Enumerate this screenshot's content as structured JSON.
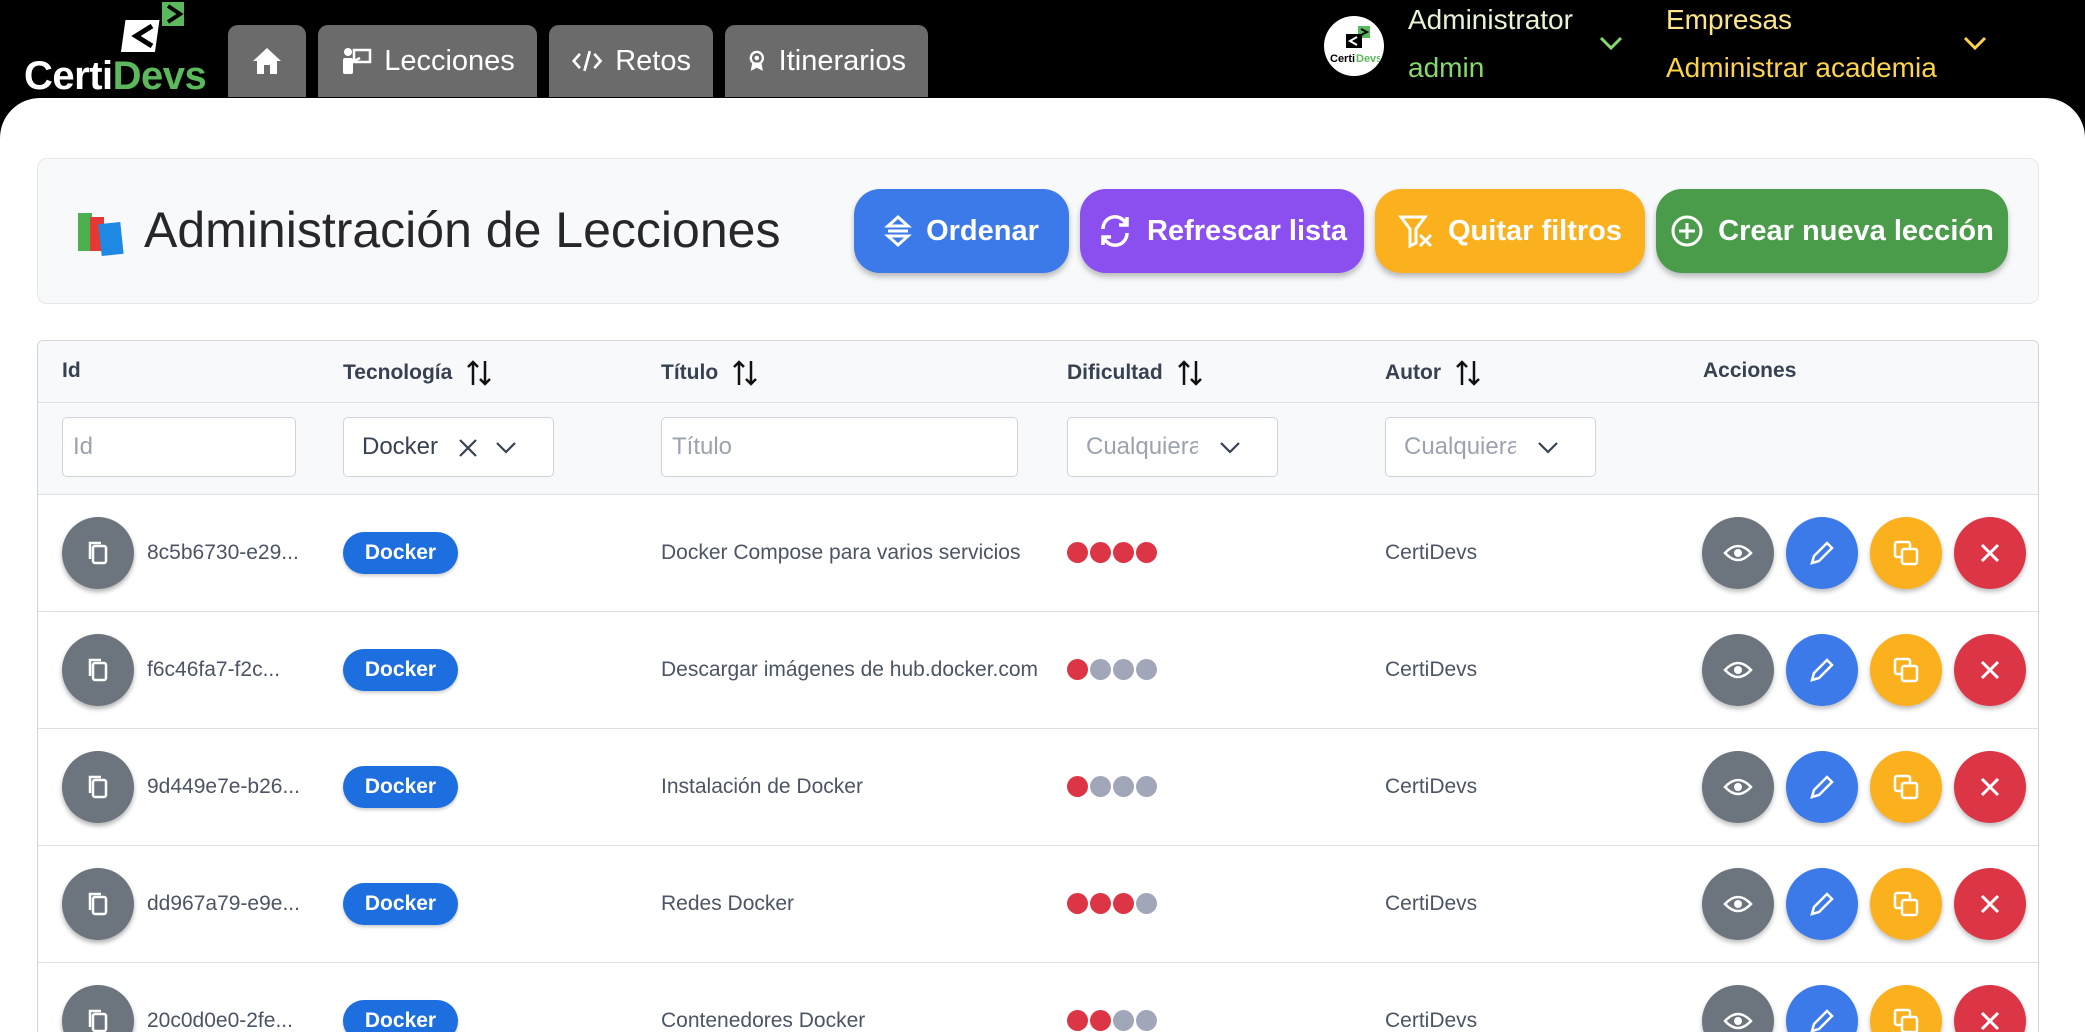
{
  "app": {
    "logo_text_part1": "Certi",
    "logo_text_part2": "Devs"
  },
  "nav": {
    "tabs": [
      {
        "label": "",
        "icon": "home-icon"
      },
      {
        "label": "Lecciones",
        "icon": "teacher-icon"
      },
      {
        "label": "Retos",
        "icon": "code-icon"
      },
      {
        "label": "Itinerarios",
        "icon": "award-icon"
      }
    ]
  },
  "user": {
    "name": "Administrator",
    "role": "admin"
  },
  "company": {
    "name": "Empresas",
    "role": "Administrar academia"
  },
  "page": {
    "title": "Administración de Lecciones"
  },
  "actions": {
    "sort_label": "Ordenar",
    "refresh_label": "Refrescar lista",
    "clear_filters_label": "Quitar filtros",
    "create_label": "Crear nueva lección"
  },
  "table": {
    "columns": {
      "id": "Id",
      "tech": "Tecnología",
      "title": "Título",
      "difficulty": "Dificultad",
      "author": "Autor",
      "actions": "Acciones"
    },
    "filters": {
      "id_placeholder": "Id",
      "tech_value": "Docker",
      "title_placeholder": "Título",
      "difficulty_placeholder": "Cualquiera",
      "author_placeholder": "Cualquiera"
    },
    "rows": [
      {
        "id": "8c5b6730-e29...",
        "tech": "Docker",
        "title": "Docker Compose para varios servicios",
        "difficulty": 4,
        "author": "CertiDevs"
      },
      {
        "id": "f6c46fa7-f2c...",
        "tech": "Docker",
        "title": "Descargar imágenes de hub.docker.com",
        "difficulty": 1,
        "author": "CertiDevs"
      },
      {
        "id": "9d449e7e-b26...",
        "tech": "Docker",
        "title": "Instalación de Docker",
        "difficulty": 1,
        "author": "CertiDevs"
      },
      {
        "id": "dd967a79-e9e...",
        "tech": "Docker",
        "title": "Redes Docker",
        "difficulty": 3,
        "author": "CertiDevs"
      },
      {
        "id": "20c0d0e0-2fe...",
        "tech": "Docker",
        "title": "Contenedores Docker",
        "difficulty": 2,
        "author": "CertiDevs"
      }
    ]
  },
  "colors": {
    "primary": "#3b7ae8",
    "purple": "#8b4ff0",
    "warning": "#fbb01d",
    "success": "#4a9c4a",
    "danger": "#dc3545",
    "secondary": "#6c757d",
    "difficulty_on": "#dc3545",
    "difficulty_off": "#a1a6b8"
  }
}
